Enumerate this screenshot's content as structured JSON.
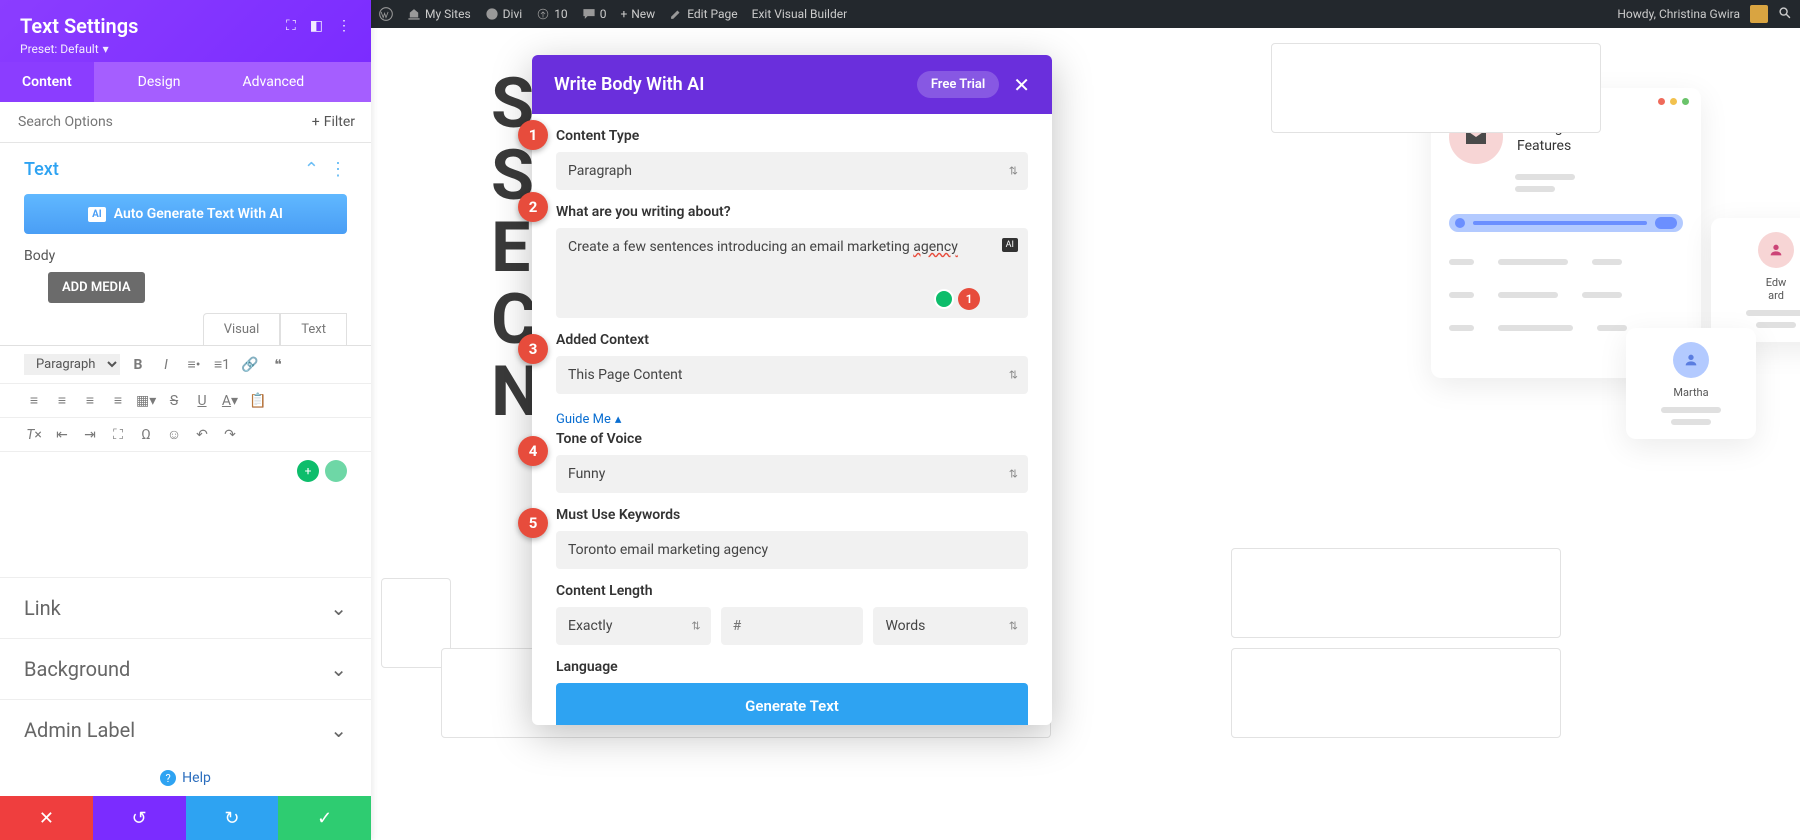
{
  "adminBar": {
    "mySites": "My Sites",
    "theme": "Divi",
    "updates": "10",
    "comments": "0",
    "new": "New",
    "editPage": "Edit Page",
    "exit": "Exit Visual Builder",
    "howdy": "Howdy, Christina Gwira"
  },
  "sidebar": {
    "title": "Text Settings",
    "preset": "Preset: Default",
    "tabs": {
      "content": "Content",
      "design": "Design",
      "advanced": "Advanced"
    },
    "searchPlaceholder": "Search Options",
    "filter": "Filter",
    "textSection": "Text",
    "autoGen": "Auto Generate Text With AI",
    "aiBadge": "AI",
    "bodyLabel": "Body",
    "addMedia": "ADD MEDIA",
    "editorTabs": {
      "visual": "Visual",
      "text": "Text"
    },
    "formatSelect": "Paragraph",
    "accordion": {
      "link": "Link",
      "background": "Background",
      "adminLabel": "Admin Label"
    },
    "help": "Help"
  },
  "modal": {
    "title": "Write Body With AI",
    "freeTrial": "Free Trial",
    "step1": "1",
    "step2": "2",
    "step3": "3",
    "step4": "4",
    "step5": "5",
    "contentType": {
      "label": "Content Type",
      "value": "Paragraph"
    },
    "about": {
      "label": "What are you writing about?",
      "value_pre": "Create a few sentences introducing an email marketing ",
      "value_agency": "agency"
    },
    "context": {
      "label": "Added Context",
      "value": "This Page Content"
    },
    "guide": "Guide Me",
    "tone": {
      "label": "Tone of Voice",
      "value": "Funny"
    },
    "keywords": {
      "label": "Must Use Keywords",
      "value": "Toronto email marketing agency"
    },
    "length": {
      "label": "Content Length",
      "mode": "Exactly",
      "numPlaceholder": "#",
      "unit": "Words"
    },
    "language": "Language",
    "generate": "Generate Text",
    "grammarlyCount": "1"
  },
  "mock": {
    "mailingTitle": "Mailing\nFeatures",
    "edw": "Edw\nard",
    "martha": "Martha"
  }
}
